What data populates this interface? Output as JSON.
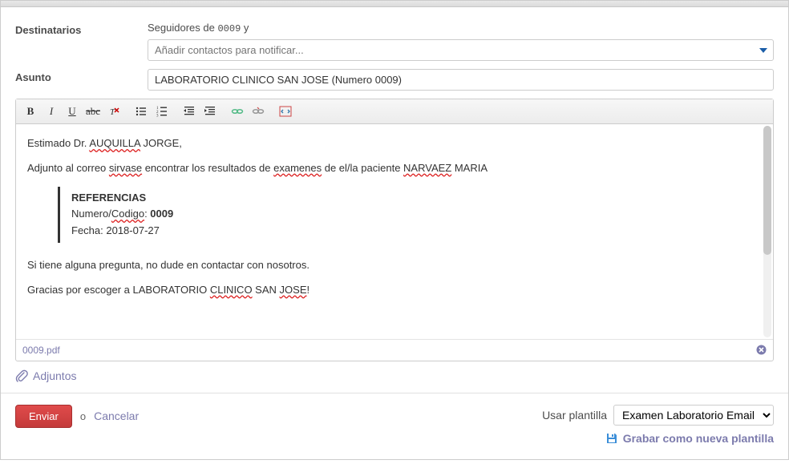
{
  "fields": {
    "recipients_label": "Destinatarios",
    "subject_label": "Asunto",
    "followers_prefix": "Seguidores de",
    "followers_id": "0009",
    "followers_suffix": "y",
    "contacts_placeholder": "Añadir contactos para notificar...",
    "subject_value": "LABORATORIO CLINICO SAN JOSE (Numero 0009)"
  },
  "body": {
    "greeting_prefix": "Estimado Dr. ",
    "greeting_name": "AUQUILLA",
    "greeting_name2": " JORGE,",
    "line2_a": "Adjunto al correo ",
    "line2_b": "sirvase",
    "line2_c": " encontrar los resultados de ",
    "line2_d": "examenes",
    "line2_e": " de el/la paciente ",
    "line2_f": "NARVAEZ",
    "line2_g": " MARIA",
    "ref_title": "REFERENCIAS",
    "ref_num_label": "Numero/",
    "ref_code_label": "Codigo",
    "ref_colon": ": ",
    "ref_num_value": "0009",
    "ref_date_label": "Fecha: ",
    "ref_date_value": "2018-07-27",
    "line3": "Si tiene alguna pregunta, no dude en contactar con nosotros.",
    "line4_a": "Gracias por escoger a LABORATORIO ",
    "line4_b": "CLINICO",
    "line4_c": " SAN ",
    "line4_d": "JOSE",
    "line4_e": "!"
  },
  "attachment": {
    "filename": "0009.pdf",
    "add_label": "Adjuntos"
  },
  "footer": {
    "send": "Enviar",
    "or": "o",
    "cancel": "Cancelar",
    "template_label": "Usar plantilla",
    "template_value": "Examen Laboratorio Email",
    "save_template": "Grabar como nueva plantilla"
  },
  "toolbar": {
    "bold": "B",
    "italic": "I",
    "underline": "U"
  }
}
